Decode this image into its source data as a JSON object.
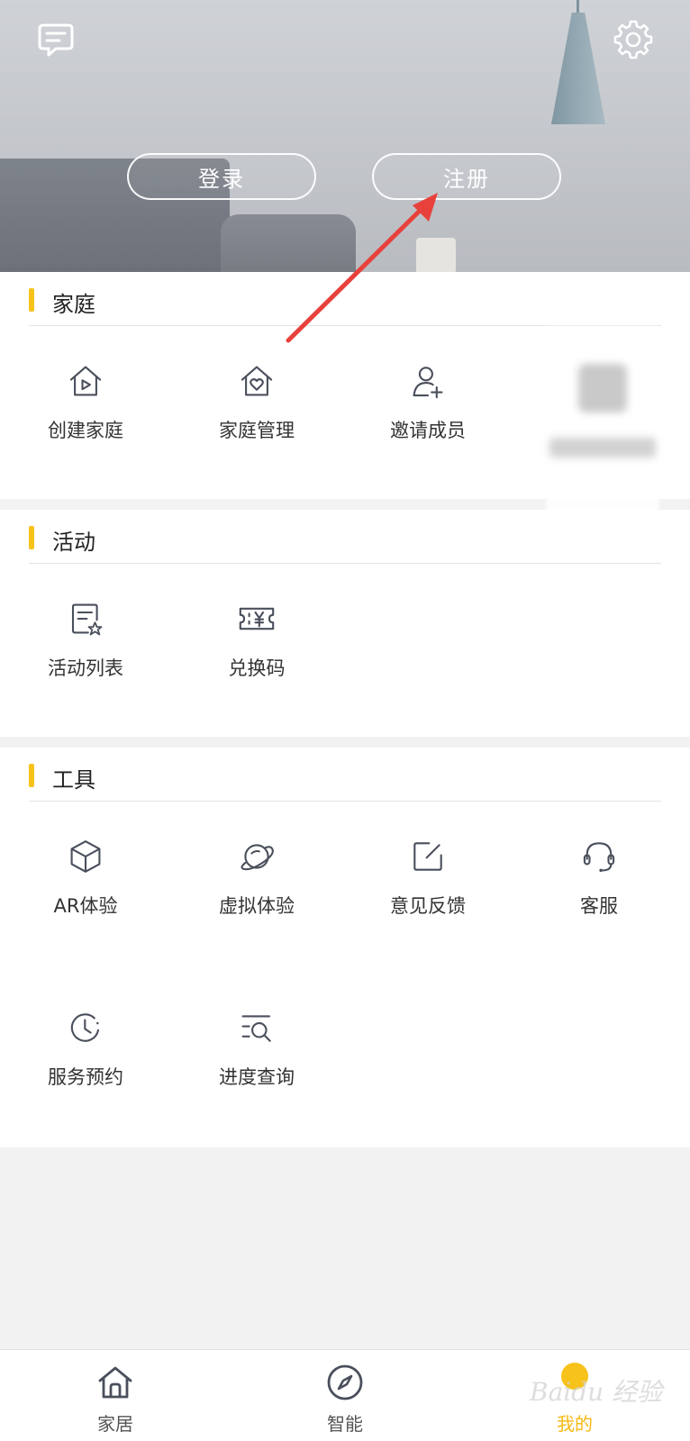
{
  "header": {
    "login_label": "登录",
    "register_label": "注册"
  },
  "sections": {
    "family": {
      "title": "家庭",
      "items": [
        {
          "label": "创建家庭",
          "icon": "house-play-icon"
        },
        {
          "label": "家庭管理",
          "icon": "house-heart-icon"
        },
        {
          "label": "邀请成员",
          "icon": "add-user-icon"
        }
      ]
    },
    "activity": {
      "title": "活动",
      "items": [
        {
          "label": "活动列表",
          "icon": "document-star-icon"
        },
        {
          "label": "兑换码",
          "icon": "ticket-yen-icon"
        }
      ]
    },
    "tools": {
      "title": "工具",
      "items": [
        {
          "label": "AR体验",
          "icon": "cube-icon"
        },
        {
          "label": "虚拟体验",
          "icon": "planet-icon"
        },
        {
          "label": "意见反馈",
          "icon": "edit-square-icon"
        },
        {
          "label": "客服",
          "icon": "headset-icon"
        },
        {
          "label": "服务预约",
          "icon": "clock-icon"
        },
        {
          "label": "进度查询",
          "icon": "list-search-icon"
        }
      ]
    }
  },
  "tabbar": {
    "tabs": [
      {
        "label": "家居",
        "icon": "home-icon"
      },
      {
        "label": "智能",
        "icon": "compass-icon"
      },
      {
        "label": "我的",
        "icon": "profile-icon"
      }
    ],
    "active_index": 2
  },
  "watermark": "Baidu 经验",
  "colors": {
    "accent": "#f7c21a",
    "active_tab_text": "#f5b914",
    "annotation": "#e8413c",
    "icon_stroke": "#4a4f5c"
  }
}
